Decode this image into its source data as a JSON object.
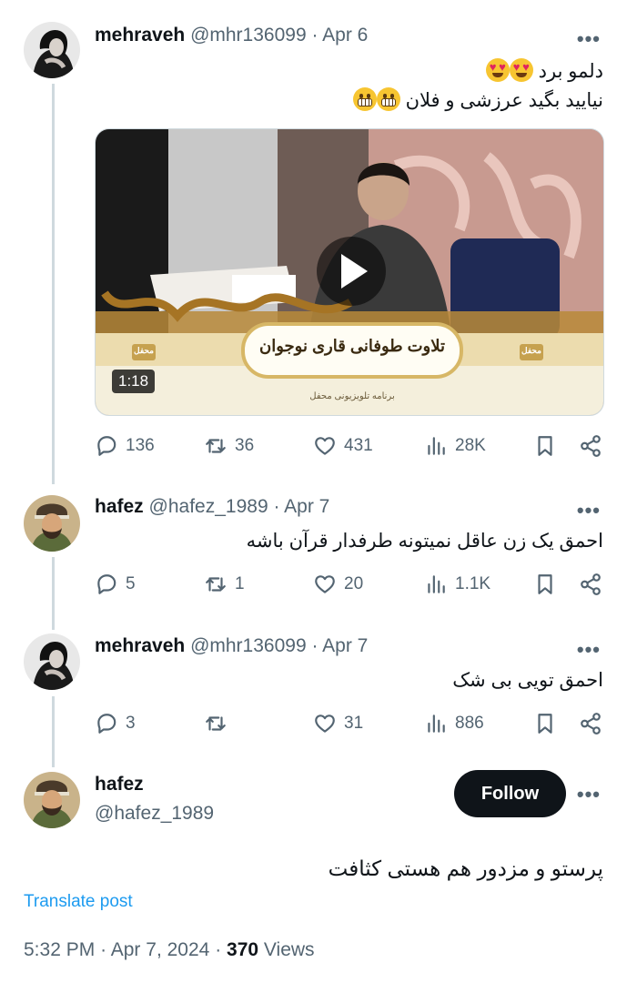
{
  "tweets": [
    {
      "name": "mehraveh",
      "handle": "@mhr136099",
      "date": "Apr 6",
      "text_line1": "دلمو برد",
      "text_line2": "نیایید بگید عرزشی و فلان",
      "video": {
        "banner_title": "تلاوت طوفانی قاری نوجوان",
        "banner_subtitle": "برنامه تلویزیونی محفل",
        "logo_text": "محفل",
        "duration": "1:18"
      },
      "replies": "136",
      "reposts": "36",
      "likes": "431",
      "views": "28K"
    },
    {
      "name": "hafez",
      "handle": "@hafez_1989",
      "date": "Apr 7",
      "text": "احمق یک زن عاقل نمیتونه طرفدار قرآن باشه",
      "replies": "5",
      "reposts": "1",
      "likes": "20",
      "views": "1.1K"
    },
    {
      "name": "mehraveh",
      "handle": "@mhr136099",
      "date": "Apr 7",
      "text": "احمق تویی بی شک",
      "replies": "3",
      "reposts": "",
      "likes": "31",
      "views": "886"
    }
  ],
  "main_post": {
    "name": "hafez",
    "handle": "@hafez_1989",
    "follow_label": "Follow",
    "text": "پرستو و مزدور هم هستی کثافت",
    "translate_label": "Translate post",
    "time": "5:32 PM",
    "date": "Apr 7, 2024",
    "views_count": "370",
    "views_label": "Views"
  },
  "separator": "·",
  "more_glyph": "•••",
  "icons": [
    "reply-icon",
    "repost-icon",
    "like-icon",
    "views-icon",
    "bookmark-icon",
    "share-icon",
    "play-icon"
  ],
  "colors": {
    "text": "#0f1419",
    "muted": "#536471",
    "link": "#1d9bf0",
    "line": "#cfd9de",
    "follow_bg": "#0f1419"
  }
}
